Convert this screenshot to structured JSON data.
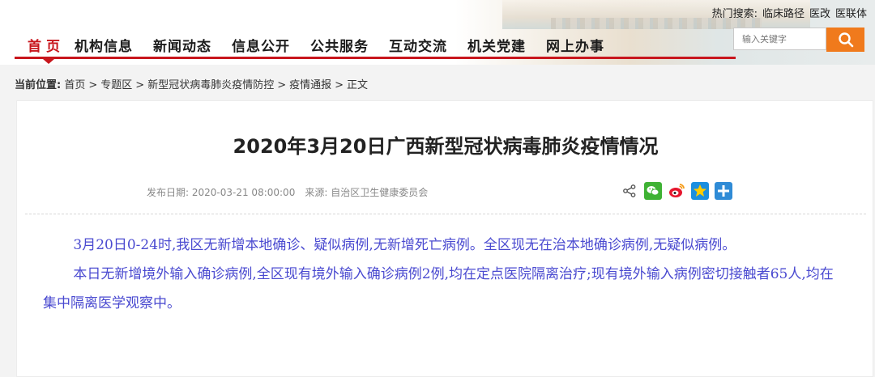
{
  "header": {
    "hot_search_label": "热门搜索:",
    "hot_search_items": [
      "临床路径",
      "医改",
      "医联体"
    ],
    "nav": [
      "首页",
      "机构信息",
      "新闻动态",
      "信息公开",
      "公共服务",
      "互动交流",
      "机关党建",
      "网上办事"
    ],
    "search": {
      "placeholder": "输入关键字",
      "button_icon": "search-icon"
    }
  },
  "breadcrumb": {
    "label": "当前位置:",
    "items": [
      "首页",
      "专题区",
      "新型冠状病毒肺炎疫情防控",
      "疫情通报",
      "正文"
    ],
    "separator": ">"
  },
  "article": {
    "title": "2020年3月20日广西新型冠状病毒肺炎疫情情况",
    "publish_label": "发布日期:",
    "publish_date": "2020-03-21 08:00:00",
    "source_label": "来源:",
    "source": "自治区卫生健康委员会",
    "share_icons": [
      "share-icon",
      "wechat-icon",
      "weibo-icon",
      "qzone-icon",
      "more-share-icon"
    ],
    "paragraphs": [
      "3月20日0-24时,我区无新增本地确诊、疑似病例,无新增死亡病例。全区现无在治本地确诊病例,无疑似病例。",
      "本日无新增境外输入确诊病例,全区现有境外输入确诊病例2例,均在定点医院隔离治疗;现有境外输入病例密切接触者65人,均在集中隔离医学观察中。"
    ]
  },
  "colors": {
    "brand_red": "#c8161d",
    "search_orange": "#f07a1c",
    "body_text": "#4a4ad0"
  }
}
